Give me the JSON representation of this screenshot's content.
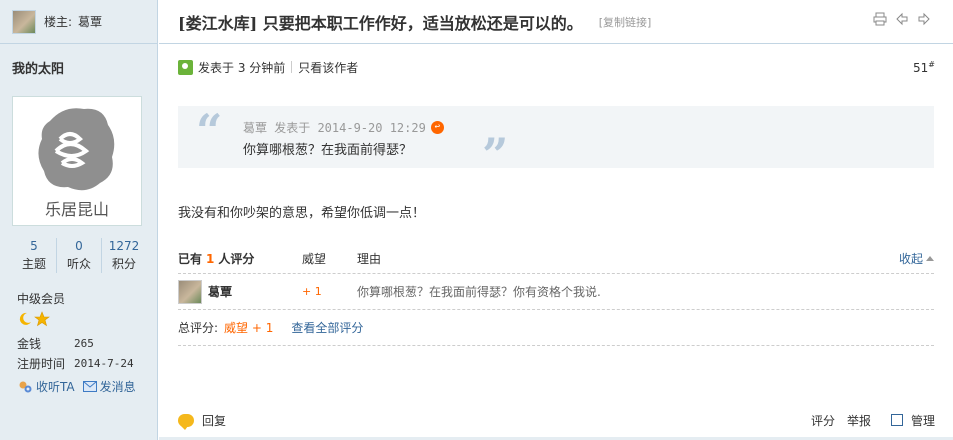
{
  "sidebar": {
    "host_label": "楼主:",
    "host_name": "葛覃",
    "username": "我的太阳",
    "avatar_text": "乐居昆山",
    "stats": [
      {
        "num": "5",
        "label": "主题"
      },
      {
        "num": "0",
        "label": "听众"
      },
      {
        "num": "1272",
        "label": "积分"
      }
    ],
    "rank": "中级会员",
    "money_label": "金钱",
    "money_value": "265",
    "reg_label": "注册时间",
    "reg_value": "2014-7-24",
    "follow_label": "收听TA",
    "message_label": "发消息"
  },
  "thread": {
    "title": "[娄江水库] 只要把本职工作作好，适当放松还是可以的。",
    "copy_link": "[复制链接]"
  },
  "post": {
    "posted": "发表于  3 分钟前",
    "author_only": "只看该作者",
    "floor": "51",
    "floor_suffix": "#",
    "quote_meta": "葛覃 发表于 2014-9-20 12:29",
    "quote_text": "你算哪根葱？在我面前得瑟？",
    "body": "我没有和你吵架的意思，希望你低调一点！"
  },
  "rating": {
    "head_prefix": "已有",
    "head_count": "1",
    "head_suffix": "人评分",
    "col_points": "威望",
    "col_reason": "理由",
    "collapse": "收起",
    "rows": [
      {
        "name": "葛覃",
        "value": "+ 1",
        "reason": "你算哪根葱？在我面前得瑟？你有资格个我说."
      }
    ],
    "total_label": "总评分:",
    "total_value": "威望  + 1",
    "view_all": "查看全部评分"
  },
  "footer": {
    "reply": "回复",
    "rate": "评分",
    "report": "举报",
    "manage": "管理"
  }
}
